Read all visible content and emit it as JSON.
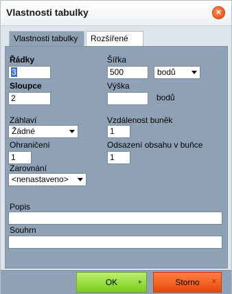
{
  "dialog": {
    "title": "Vlastnosti tabulky",
    "close_glyph": "×"
  },
  "tabs": [
    {
      "label": "Vlastnosti tabulky",
      "active": true
    },
    {
      "label": "Rozšířené",
      "active": false
    }
  ],
  "fields": {
    "rows": {
      "label": "Řádky",
      "value": "3"
    },
    "columns": {
      "label": "Sloupce",
      "value": "2"
    },
    "width": {
      "label": "Šířka",
      "value": "500",
      "unit": "bodů"
    },
    "height": {
      "label": "Výška",
      "value": "",
      "unit": "bodů"
    },
    "header": {
      "label": "Záhlaví",
      "value": "Žádné"
    },
    "border": {
      "label": "Ohraničení",
      "value": "1"
    },
    "cell_spacing": {
      "label": "Vzdálenost buněk",
      "value": "1"
    },
    "cell_padding": {
      "label": "Odsazení obsahu v buňce",
      "value": "1"
    },
    "alignment": {
      "label": "Zarovnání",
      "value": "<nenastaveno>"
    },
    "caption": {
      "label": "Popis",
      "value": ""
    },
    "summary": {
      "label": "Souhrn",
      "value": ""
    }
  },
  "buttons": {
    "ok": {
      "label": "OK",
      "mark": "▸"
    },
    "cancel": {
      "label": "Storno",
      "mark": "✕"
    }
  },
  "colors": {
    "panel": "#8fa2b5",
    "ok_button": "#9bdc45",
    "cancel_button": "#f2611f",
    "close_button": "#e8561a",
    "selection": "#3a72c8"
  }
}
